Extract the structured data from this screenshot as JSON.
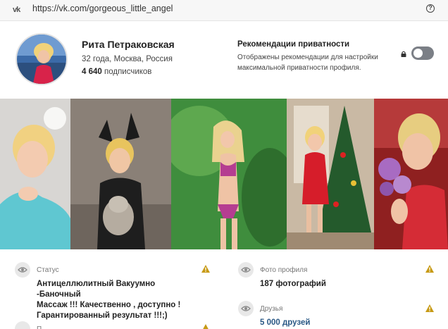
{
  "browser": {
    "url": "https://vk.com/gorgeous_little_angel",
    "site_icon": "vk-logo-icon",
    "vk_icon_text": "vk",
    "help_icon_text": "?"
  },
  "profile": {
    "name": "Рита Петраковская",
    "meta": "32 года, Москва, Россия",
    "followers_count": "4 640",
    "followers_label": "подписчиков"
  },
  "privacy": {
    "title": "Рекомендации приватности",
    "description": "Отображены рекомендации для настройки максимальной приватности профиля.",
    "toggle_on": false
  },
  "photos": [
    {
      "name": "photo-1"
    },
    {
      "name": "photo-2"
    },
    {
      "name": "photo-3"
    },
    {
      "name": "photo-4"
    },
    {
      "name": "photo-5"
    }
  ],
  "cards": {
    "status": {
      "label": "Статус",
      "text_line1": "Антицеллюлитный Вакуумно -Баночный",
      "text_line2": "Массаж !!! Качественно , доступно !",
      "text_line3": "Гарантированный результат !!!;)"
    },
    "photos_card": {
      "label": "Фото профиля",
      "value": "187 фотографий"
    },
    "friends": {
      "label": "Друзья",
      "value": "5 000 друзей"
    },
    "next_label": "П"
  },
  "colors": {
    "warning": "#c79a15",
    "link": "#2a5885",
    "toggle_off": "#7b7f86"
  }
}
